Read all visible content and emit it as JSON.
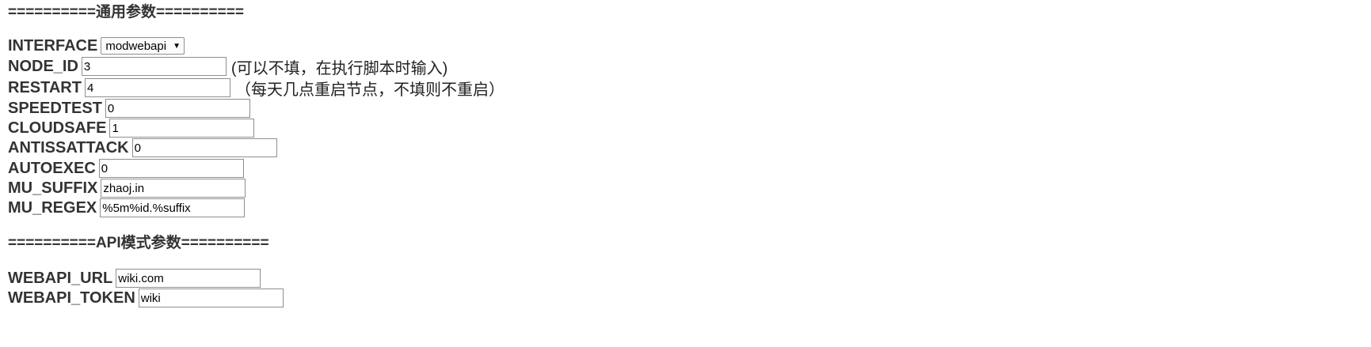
{
  "sections": {
    "general": "==========通用参数==========",
    "api": "==========API模式参数=========="
  },
  "interface": {
    "label": "INTERFACE",
    "selected": "modwebapi",
    "arrow_icon": "triangle-down"
  },
  "fields": {
    "node_id": {
      "label": "NODE_ID",
      "value": "3",
      "hint": "(可以不填，在执行脚本时输入)"
    },
    "restart": {
      "label": "RESTART",
      "value": "4",
      "hint": "（每天几点重启节点，不填则不重启）"
    },
    "speedtest": {
      "label": "SPEEDTEST",
      "value": "0"
    },
    "cloudsafe": {
      "label": "CLOUDSAFE",
      "value": "1"
    },
    "antissattack": {
      "label": "ANTISSATTACK",
      "value": "0"
    },
    "autoexec": {
      "label": "AUTOEXEC",
      "value": "0"
    },
    "mu_suffix": {
      "label": "MU_SUFFIX",
      "value": "zhaoj.in"
    },
    "mu_regex": {
      "label": "MU_REGEX",
      "value": "%5m%id.%suffix"
    },
    "webapi_url": {
      "label": "WEBAPI_URL",
      "value": "wiki.com"
    },
    "webapi_token": {
      "label": "WEBAPI_TOKEN",
      "value": "wiki"
    }
  }
}
